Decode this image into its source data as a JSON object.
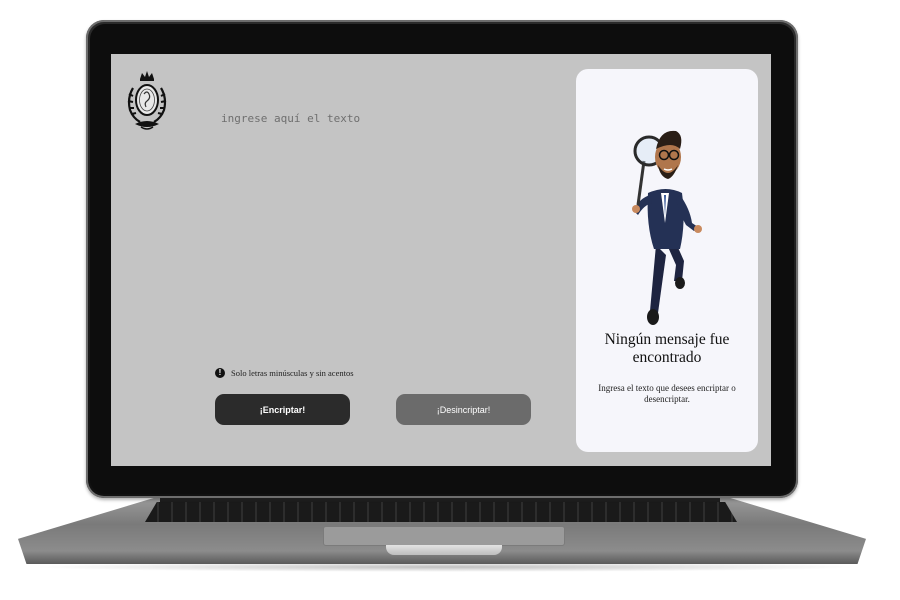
{
  "app": {
    "input_placeholder": "ingrese aquí el texto",
    "hint_icon": "!",
    "hint_text": "Solo letras minúsculas y sin acentos",
    "encrypt_label": "¡Encriptar!",
    "decrypt_label": "¡Desincriptar!"
  },
  "panel": {
    "title": "Ningún mensaje fue encontrado",
    "description": "Ingresa el texto que desees encriptar o desencriptar."
  },
  "icons": {
    "logo": "crest-logo-icon",
    "hint": "exclamation-circle-icon",
    "illustration": "detective-magnifier-illustration"
  },
  "colors": {
    "screen_background": "#c4c4c4",
    "panel_background": "#f6f6fb",
    "encrypt_button": "#2b2b2b",
    "decrypt_button": "#6b6b6b"
  }
}
